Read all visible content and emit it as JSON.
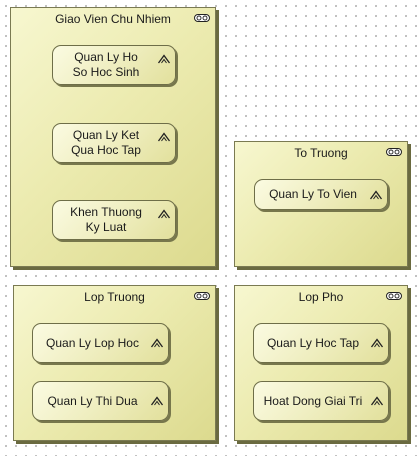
{
  "packages": {
    "giao_vien": {
      "title": "Giao Vien Chu Nhiem",
      "use_cases": [
        "Quan Ly Ho\nSo Hoc Sinh",
        "Quan Ly Ket\nQua Hoc Tap",
        "Khen Thuong\nKy Luat"
      ]
    },
    "to_truong": {
      "title": "To Truong",
      "use_cases": [
        "Quan Ly To Vien"
      ]
    },
    "lop_truong": {
      "title": "Lop Truong",
      "use_cases": [
        "Quan Ly Lop Hoc",
        "Quan Ly Thi Dua"
      ]
    },
    "lop_pho": {
      "title": "Lop Pho",
      "use_cases": [
        "Quan Ly Hoc Tap",
        "Hoat Dong Giai Tri"
      ]
    }
  },
  "icons": {
    "package_icon": "collapse-toggle-icon",
    "use_case_icon": "chevron-up-icon"
  },
  "colors": {
    "package_fill": "#ecebb0",
    "use_case_fill": "#efeec0",
    "border": "#6e6e48"
  }
}
